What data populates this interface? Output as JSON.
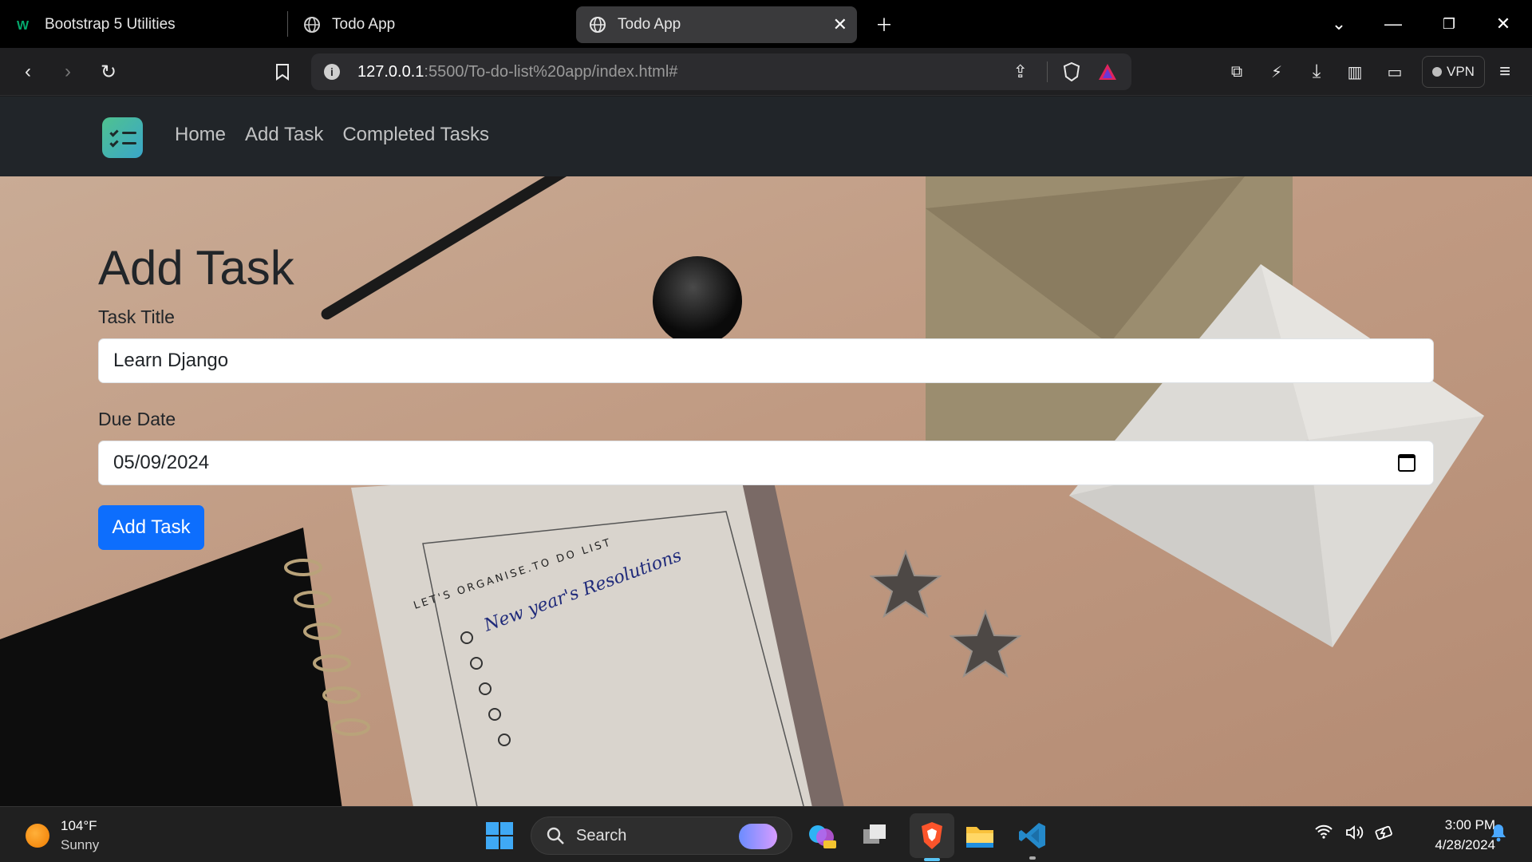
{
  "browser": {
    "tabs": [
      {
        "title": "Bootstrap 5 Utilities",
        "active": false
      },
      {
        "title": "Todo App",
        "active": false
      },
      {
        "title": "Todo App",
        "active": true
      }
    ],
    "url_host": "127.0.0.1",
    "url_path": ":5500/To-do-list%20app/index.html#",
    "vpn_label": "VPN"
  },
  "navbar": {
    "links": [
      "Home",
      "Add Task",
      "Completed Tasks"
    ]
  },
  "form": {
    "title": "Add Task",
    "task_title_label": "Task Title",
    "task_title_value": "Learn Django",
    "due_date_label": "Due Date",
    "due_date_value": "05/09/2024",
    "submit_label": "Add Task"
  },
  "hero_art": {
    "notebook_header": "LET'S ORGANISE.TO DO LIST",
    "notebook_handwriting": "New year's Resolutions"
  },
  "taskbar": {
    "weather_temp": "104°F",
    "weather_desc": "Sunny",
    "search_label": "Search",
    "time": "3:00 PM",
    "date": "4/28/2024"
  },
  "colors": {
    "primary_button": "#0d6efd",
    "navbar_bg": "#212529",
    "accent_logo": "#4fc28f"
  }
}
